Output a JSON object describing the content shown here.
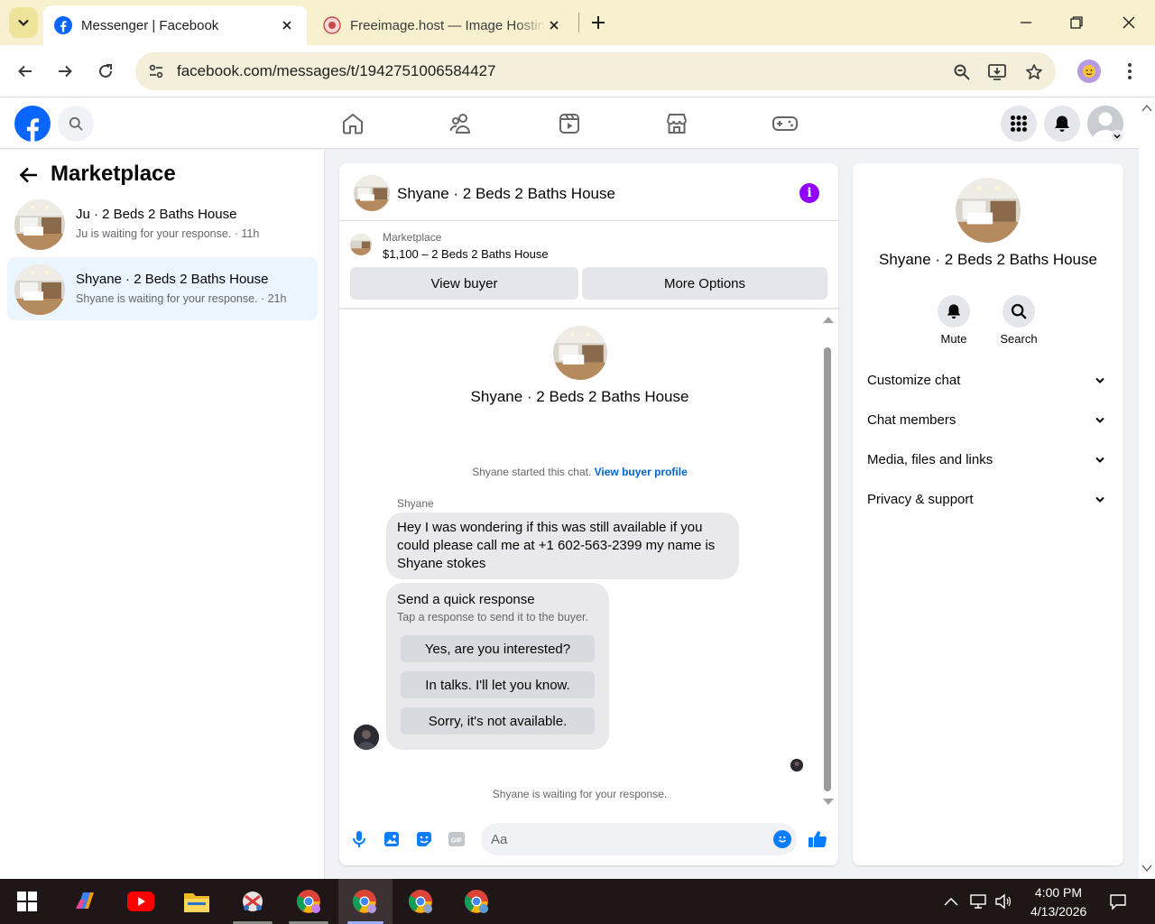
{
  "browser": {
    "tabs": [
      {
        "title": "Messenger | Facebook",
        "active": true
      },
      {
        "title": "Freeimage.host — Image Hosting",
        "active": false
      }
    ],
    "url": "facebook.com/messages/t/1942751006584427"
  },
  "fb_header": {
    "nav_icons": [
      "home-icon",
      "friends-icon",
      "video-icon",
      "marketplace-icon",
      "gaming-icon"
    ],
    "right_icons": [
      "menu-grid-icon",
      "notifications-bell-icon",
      "account-avatar"
    ]
  },
  "sidebar": {
    "title": "Marketplace",
    "conversations": [
      {
        "title": "Ju · 2 Beds 2 Baths House",
        "subtitle": "Ju is waiting for your response. · 11h",
        "selected": false
      },
      {
        "title": "Shyane · 2 Beds 2 Baths House",
        "subtitle": "Shyane is waiting for your response. · 21h",
        "selected": true
      }
    ]
  },
  "chat": {
    "header_name": "Shyane · 2 Beds 2 Baths House",
    "marketplace_label": "Marketplace",
    "listing": "$1,100 – 2 Beds 2 Baths House",
    "view_buyer": "View buyer",
    "more_options": "More Options",
    "intro_name": "Shyane · 2 Beds 2 Baths House",
    "started_text": "Shyane started this chat. ",
    "view_profile_link": "View buyer profile",
    "sender": "Shyane",
    "message": "Hey I was wondering if this was still available if you could please call me at +1 602-563-2399 my name is Shyane stokes",
    "quick_title": "Send a quick response",
    "quick_subtitle": "Tap a response to send it to the buyer.",
    "quick_replies": [
      "Yes, are you interested?",
      "In talks. I'll let you know.",
      "Sorry, it's not available."
    ],
    "waiting": "Shyane is waiting for your response.",
    "composer_placeholder": "Aa",
    "accent": "#0a7cff"
  },
  "info_panel": {
    "name": "Shyane · 2 Beds 2 Baths House",
    "actions": [
      {
        "label": "Mute",
        "icon": "bell-icon"
      },
      {
        "label": "Search",
        "icon": "search-icon"
      }
    ],
    "sections": [
      "Customize chat",
      "Chat members",
      "Media, files and links",
      "Privacy & support"
    ]
  },
  "taskbar": {
    "time": "4:00 PM",
    "date": "4/13/2026"
  }
}
